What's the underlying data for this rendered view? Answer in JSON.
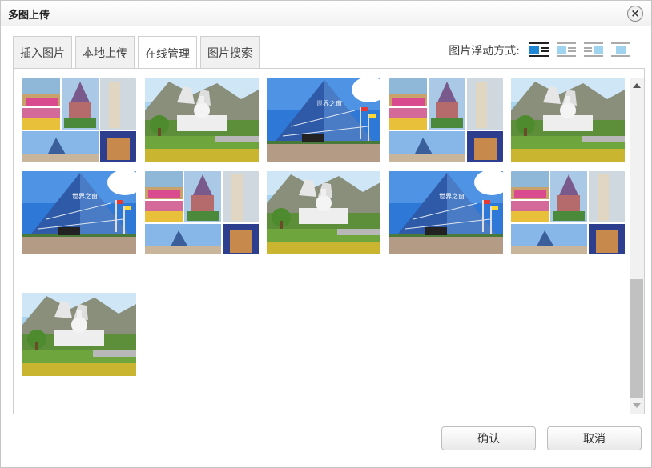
{
  "dialog": {
    "title": "多图上传",
    "close_label": "×"
  },
  "tabs": [
    {
      "label": "插入图片",
      "active": false
    },
    {
      "label": "本地上传",
      "active": false
    },
    {
      "label": "在线管理",
      "active": true
    },
    {
      "label": "图片搜索",
      "active": false
    }
  ],
  "float_mode": {
    "label": "图片浮动方式:",
    "options": [
      {
        "icon": "float-none-icon",
        "selected": true
      },
      {
        "icon": "float-left-icon",
        "selected": false
      },
      {
        "icon": "float-right-icon",
        "selected": false
      },
      {
        "icon": "float-center-icon",
        "selected": false
      }
    ]
  },
  "images": [
    {
      "kind": "collage"
    },
    {
      "kind": "capitol"
    },
    {
      "kind": "pyramid"
    },
    {
      "kind": "collage"
    },
    {
      "kind": "capitol"
    },
    {
      "kind": "pyramid"
    },
    {
      "kind": "collage"
    },
    {
      "kind": "capitol"
    },
    {
      "kind": "pyramid"
    },
    {
      "kind": "collage"
    },
    {
      "kind": "capitol"
    }
  ],
  "buttons": {
    "ok": "确认",
    "cancel": "取消"
  }
}
